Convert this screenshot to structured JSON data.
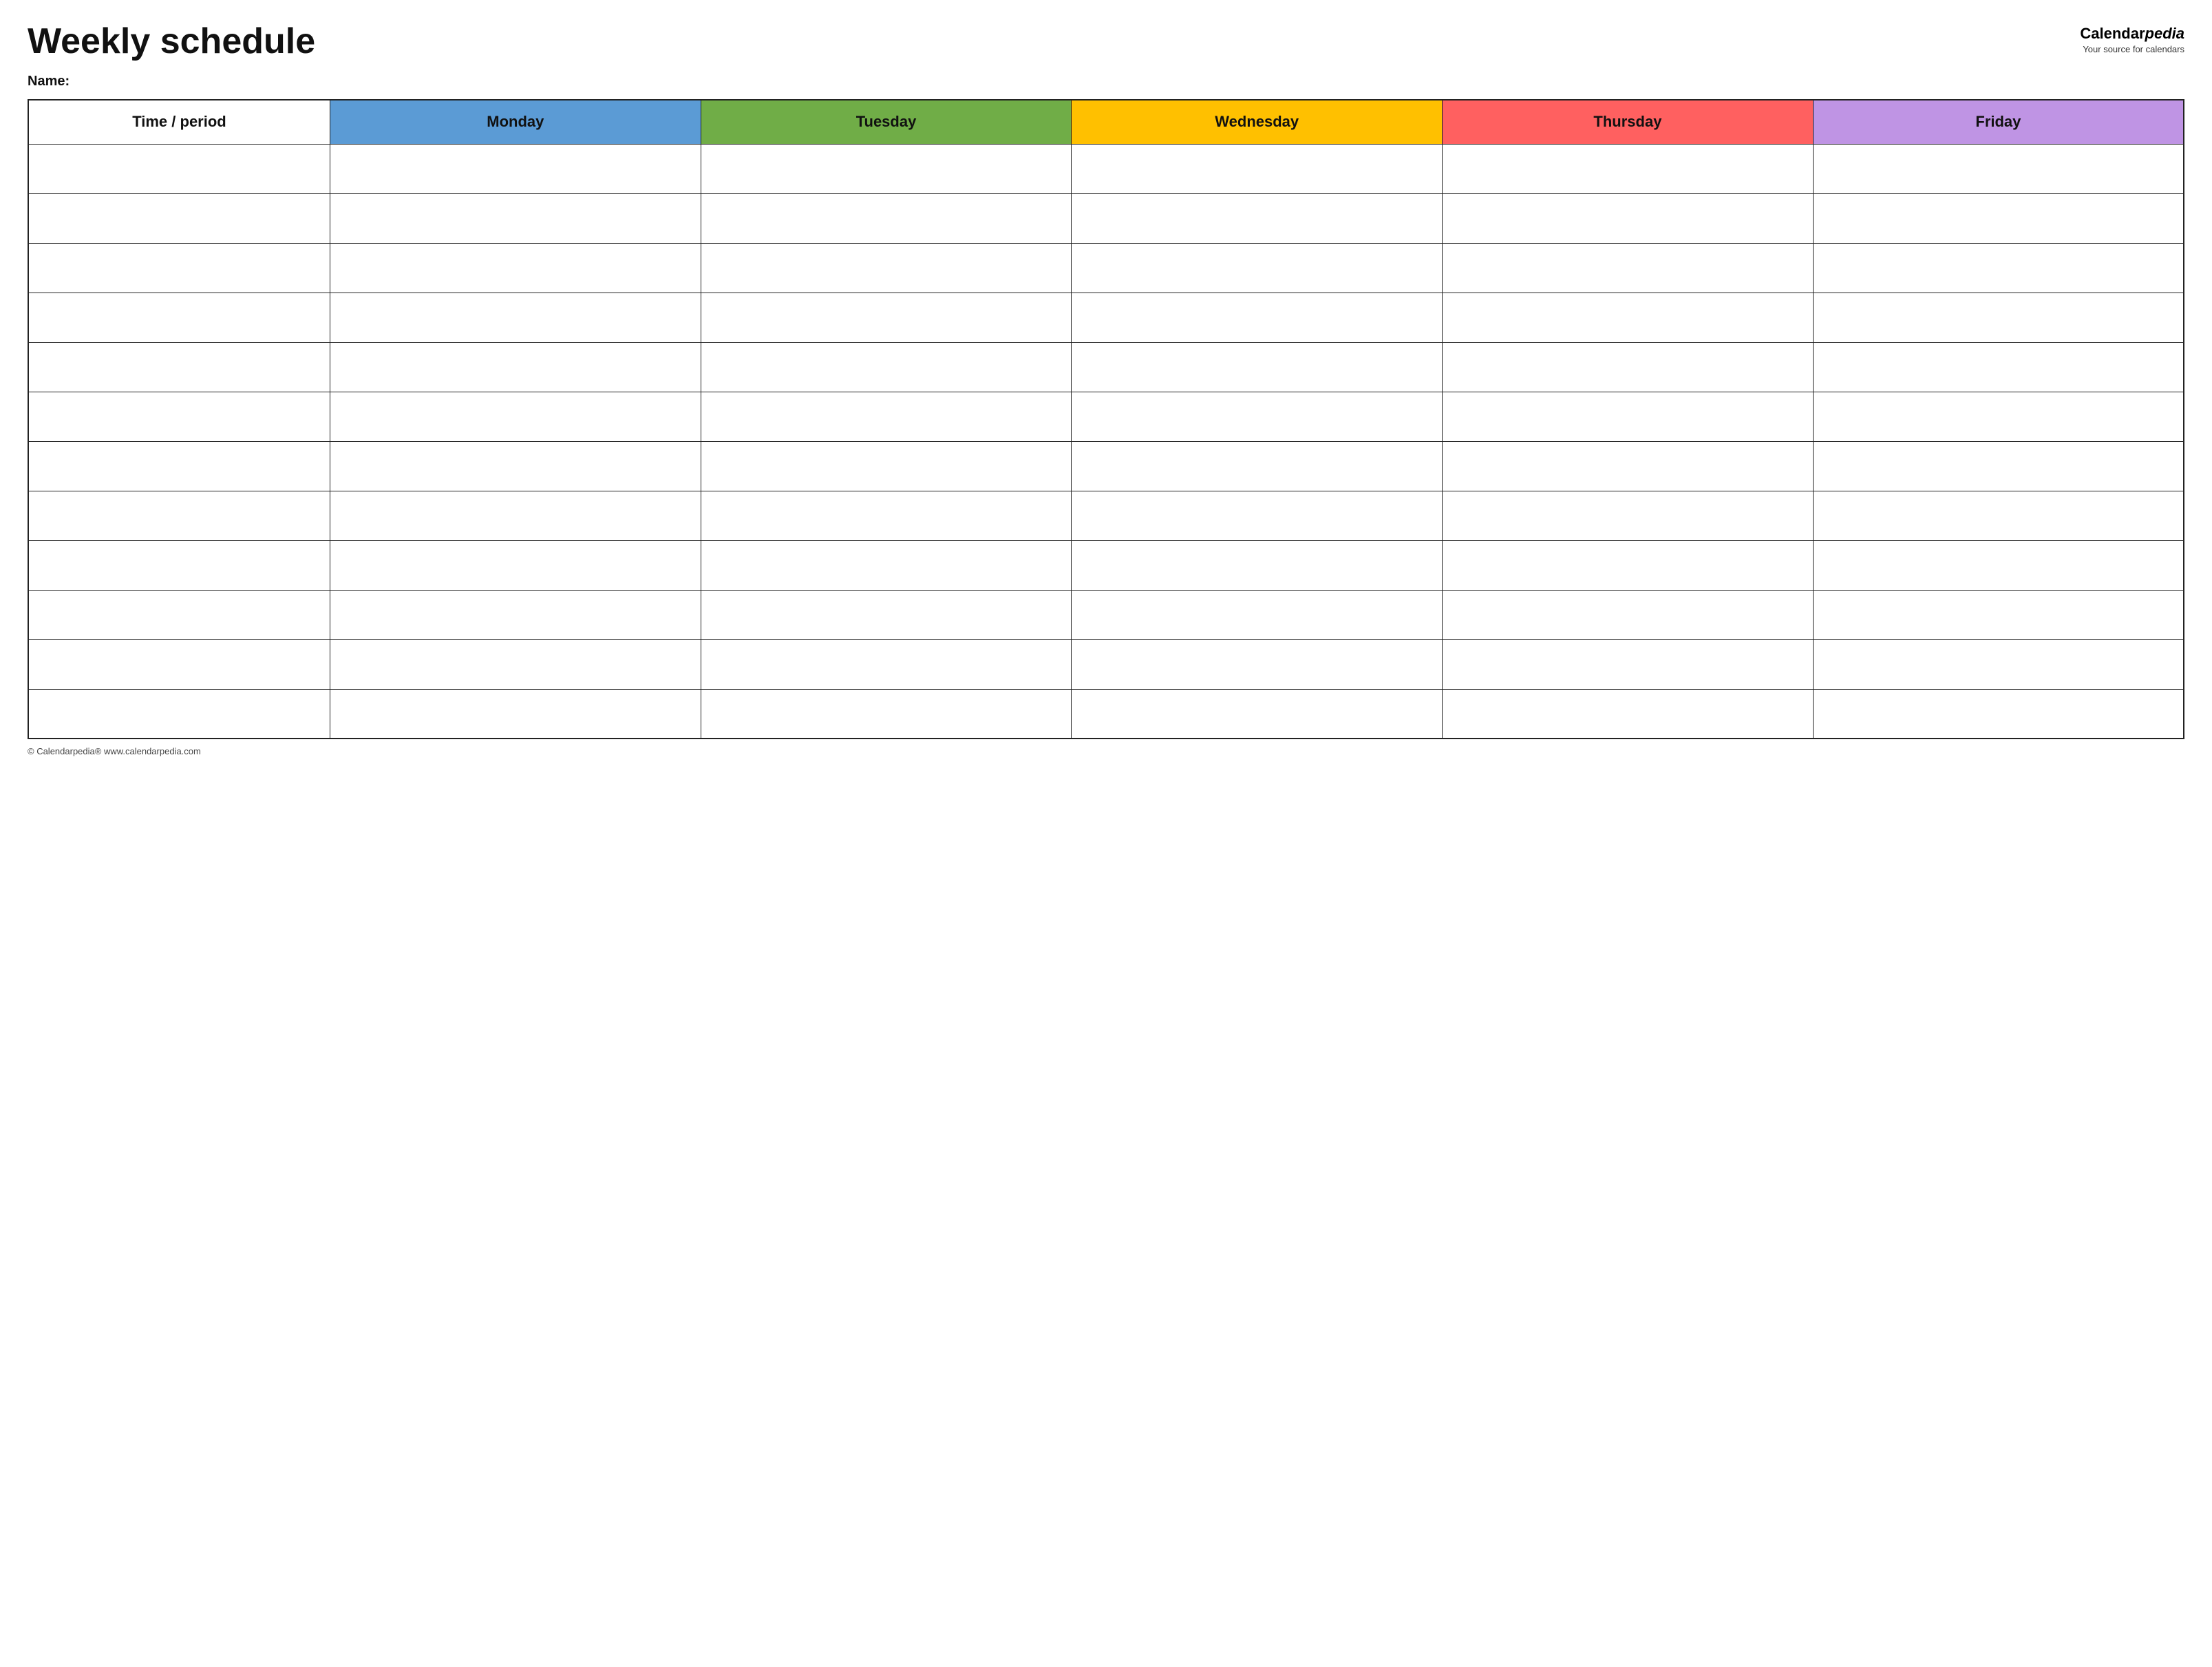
{
  "header": {
    "title": "Weekly schedule",
    "logo_calendar": "Calendar",
    "logo_pedia": "pedia",
    "logo_sub": "Your source for calendars"
  },
  "name_label": "Name:",
  "columns": [
    {
      "key": "time",
      "label": "Time / period",
      "class": "col-time"
    },
    {
      "key": "monday",
      "label": "Monday",
      "class": "col-monday"
    },
    {
      "key": "tuesday",
      "label": "Tuesday",
      "class": "col-tuesday"
    },
    {
      "key": "wednesday",
      "label": "Wednesday",
      "class": "col-wednesday"
    },
    {
      "key": "thursday",
      "label": "Thursday",
      "class": "col-thursday"
    },
    {
      "key": "friday",
      "label": "Friday",
      "class": "col-friday"
    }
  ],
  "rows": 12,
  "footer": "© Calendarpedia®  www.calendarpedia.com"
}
